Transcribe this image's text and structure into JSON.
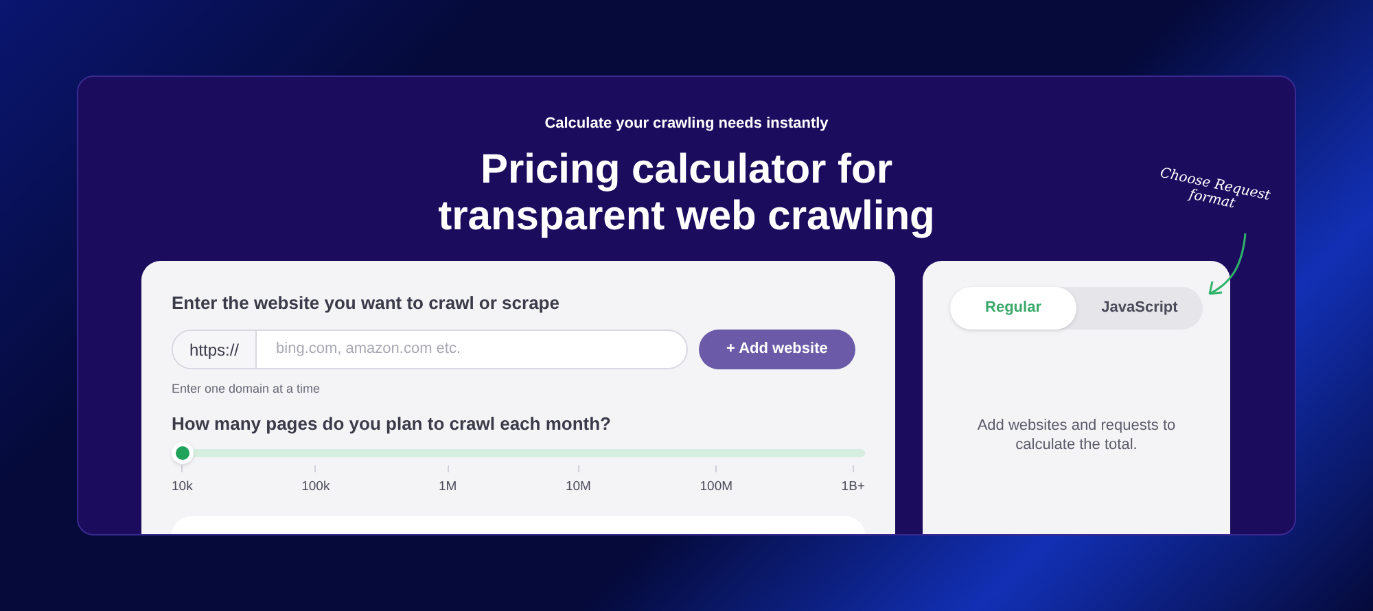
{
  "header": {
    "eyebrow": "Calculate your crawling needs instantly",
    "title_lines": [
      "Pricing calculator for",
      "transparent web crawling"
    ]
  },
  "website_form": {
    "label": "Enter the website you want to crawl or scrape",
    "prefix": "https://",
    "placeholder": "bing.com, amazon.com etc.",
    "button": "+ Add website",
    "hint": "Enter one domain at a time"
  },
  "pages_slider": {
    "label": "How many pages do you plan to crawl each month?",
    "level": 0,
    "ticks": [
      "10k",
      "100k",
      "1M",
      "10M",
      "100M",
      "1B+"
    ]
  },
  "request_format": {
    "annotation_lines": [
      "Choose Request",
      "format"
    ],
    "tabs": [
      {
        "label": "Regular",
        "selected": true
      },
      {
        "label": "JavaScript",
        "selected": false
      }
    ],
    "empty_message": "Add websites and requests to calculate the total."
  }
}
